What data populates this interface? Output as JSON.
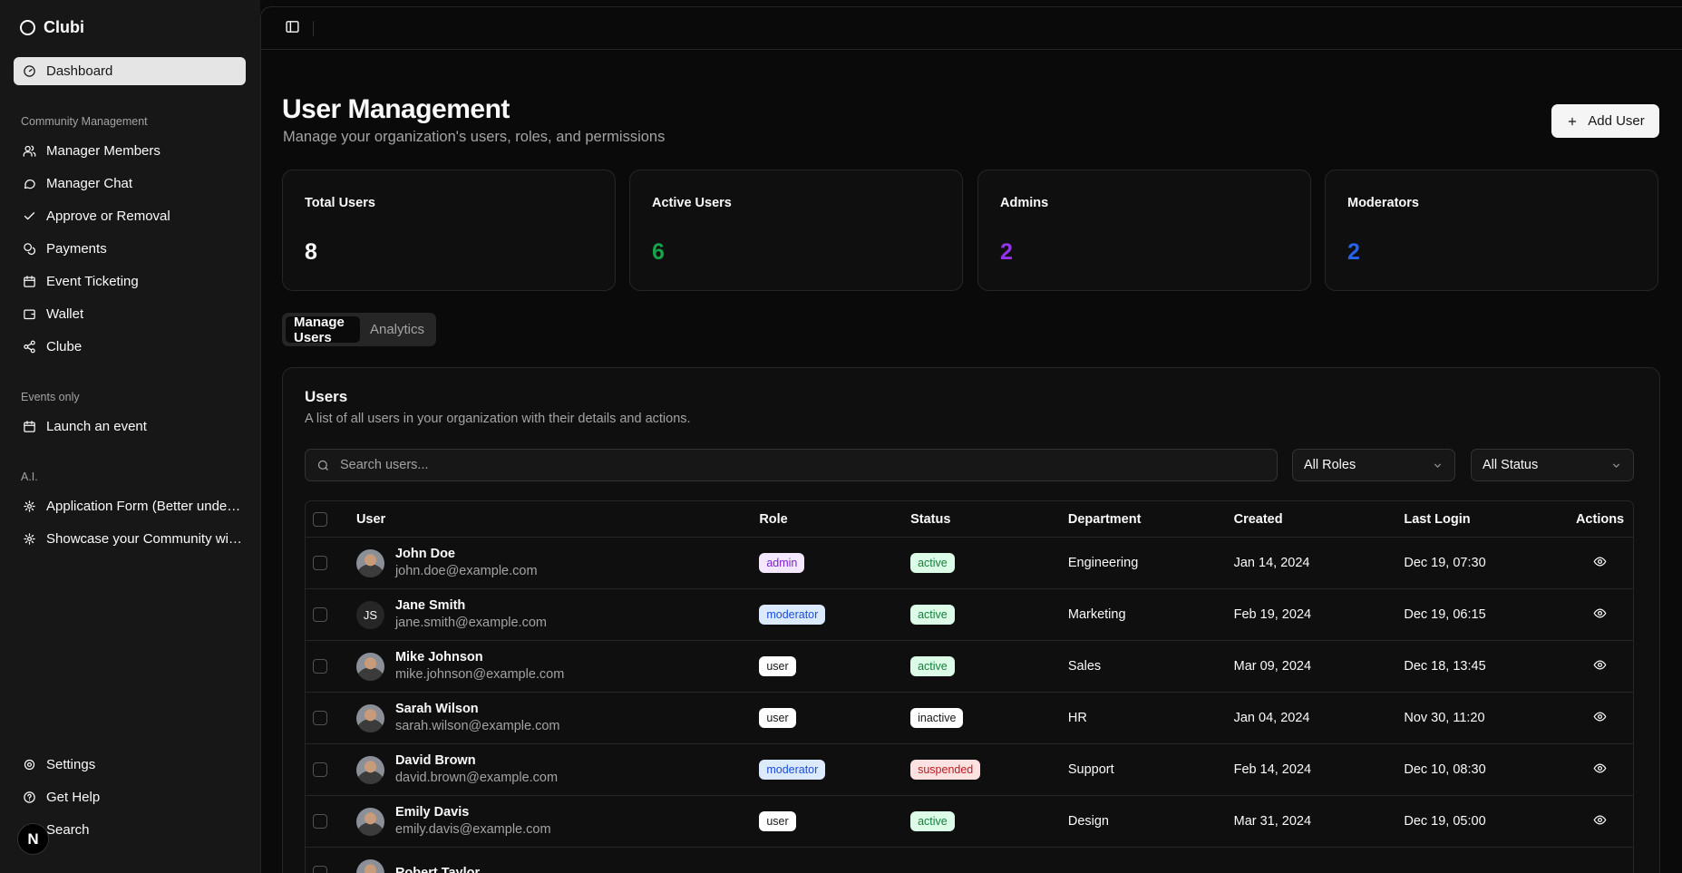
{
  "app": {
    "name": "Clubi"
  },
  "sidebar": {
    "dashboard": "Dashboard",
    "groups": [
      {
        "label": "Community Management"
      },
      {
        "label": "Events only"
      },
      {
        "label": "A.I."
      }
    ],
    "items": [
      {
        "label": "Manager Members",
        "icon": "users-icon"
      },
      {
        "label": "Manager Chat",
        "icon": "message-icon"
      },
      {
        "label": "Approve or Removal",
        "icon": "check-icon"
      },
      {
        "label": "Payments",
        "icon": "coins-icon"
      },
      {
        "label": "Event Ticketing",
        "icon": "calendar-icon"
      },
      {
        "label": "Wallet",
        "icon": "wallet-icon"
      },
      {
        "label": "Clube",
        "icon": "share-icon"
      },
      {
        "label": "Launch an event",
        "icon": "calendar-icon"
      },
      {
        "label": "Application Form (Better understanding)",
        "icon": "brain-icon"
      },
      {
        "label": "Showcase your Community with AI",
        "icon": "brain-icon"
      }
    ],
    "footer": [
      {
        "label": "Settings",
        "icon": "gear-icon"
      },
      {
        "label": "Get Help",
        "icon": "help-icon"
      },
      {
        "label": "Search",
        "icon": "search-icon"
      }
    ],
    "badge": "N"
  },
  "header": {
    "title": "User Management",
    "subtitle": "Manage your organization's users, roles, and permissions",
    "add_button": "Add User"
  },
  "stats": [
    {
      "label": "Total Users",
      "value": "8",
      "color": "#fafafa"
    },
    {
      "label": "Active Users",
      "value": "6",
      "color": "#16a34a"
    },
    {
      "label": "Admins",
      "value": "2",
      "color": "#9333ea"
    },
    {
      "label": "Moderators",
      "value": "2",
      "color": "#2563eb"
    }
  ],
  "tabs": [
    "Manage Users",
    "Analytics"
  ],
  "users_card": {
    "title": "Users",
    "subtitle": "A list of all users in your organization with their details and actions.",
    "search_placeholder": "Search users...",
    "role_filter": "All Roles",
    "status_filter": "All Status",
    "columns": [
      "User",
      "Role",
      "Status",
      "Department",
      "Created",
      "Last Login",
      "Actions"
    ],
    "rows": [
      {
        "name": "John Doe",
        "email": "john.doe@example.com",
        "avatar": "",
        "role": "admin",
        "status": "active",
        "department": "Engineering",
        "created": "Jan 14, 2024",
        "last_login": "Dec 19, 07:30"
      },
      {
        "name": "Jane Smith",
        "email": "jane.smith@example.com",
        "avatar": "JS",
        "role": "moderator",
        "status": "active",
        "department": "Marketing",
        "created": "Feb 19, 2024",
        "last_login": "Dec 19, 06:15"
      },
      {
        "name": "Mike Johnson",
        "email": "mike.johnson@example.com",
        "avatar": "",
        "role": "user",
        "status": "active",
        "department": "Sales",
        "created": "Mar 09, 2024",
        "last_login": "Dec 18, 13:45"
      },
      {
        "name": "Sarah Wilson",
        "email": "sarah.wilson@example.com",
        "avatar": "",
        "role": "user",
        "status": "inactive",
        "department": "HR",
        "created": "Jan 04, 2024",
        "last_login": "Nov 30, 11:20"
      },
      {
        "name": "David Brown",
        "email": "david.brown@example.com",
        "avatar": "",
        "role": "moderator",
        "status": "suspended",
        "department": "Support",
        "created": "Feb 14, 2024",
        "last_login": "Dec 10, 08:30"
      },
      {
        "name": "Emily Davis",
        "email": "emily.davis@example.com",
        "avatar": "",
        "role": "user",
        "status": "active",
        "department": "Design",
        "created": "Mar 31, 2024",
        "last_login": "Dec 19, 05:00"
      },
      {
        "name": "Robert Taylor",
        "email": "",
        "avatar": "",
        "role": "",
        "status": "",
        "department": "",
        "created": "",
        "last_login": ""
      }
    ]
  },
  "badge_colors": {
    "admin": {
      "bg": "#f3e8ff",
      "fg": "#7e22ce"
    },
    "moderator": {
      "bg": "#dbeafe",
      "fg": "#1d4ed8"
    },
    "user": {
      "bg": "#ffffff",
      "fg": "#171717"
    },
    "active": {
      "bg": "#dcfce7",
      "fg": "#15803d"
    },
    "inactive": {
      "bg": "#ffffff",
      "fg": "#171717"
    },
    "suspended": {
      "bg": "#fee2e2",
      "fg": "#b91c1c"
    }
  }
}
